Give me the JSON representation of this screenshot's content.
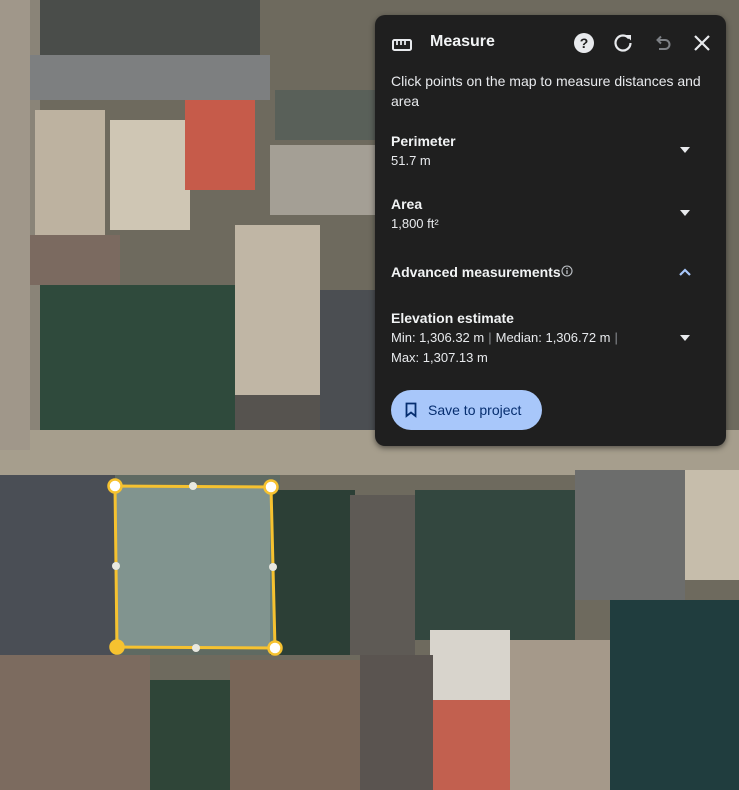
{
  "panel": {
    "title": "Measure",
    "icons": {
      "ruler": "ruler-icon",
      "help": "help-icon",
      "reset": "refresh-icon",
      "undo": "undo-icon",
      "close": "close-icon"
    },
    "description": "Click points on the map to measure distances and area",
    "perimeter": {
      "label": "Perimeter",
      "value": "51.7 m"
    },
    "area": {
      "label": "Area",
      "value": "1,800 ft²"
    },
    "advanced": {
      "label": "Advanced measurements",
      "info_icon": "info-icon",
      "expanded": true
    },
    "elevation": {
      "label": "Elevation estimate",
      "min": "Min: 1,306.32 m",
      "median": "Median: 1,306.72 m",
      "max": "Max: 1,307.13 m",
      "separator": "|"
    },
    "save_button": {
      "label": "Save to project",
      "icon": "bookmark-icon"
    }
  },
  "colors": {
    "panel_bg": "#1f1f1f",
    "accent_button": "#a8c7fa",
    "polygon_stroke": "#f6c230"
  }
}
